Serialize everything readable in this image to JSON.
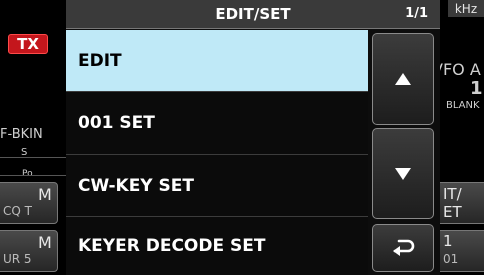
{
  "background": {
    "tx_badge": "TX",
    "freq_unit": "kHz",
    "mode_left": "F-BKIN",
    "meter_s": "S",
    "meter_po": "Po",
    "vfo_label": "VFO A",
    "vfo_digit": "1",
    "blank_label": "BLANK",
    "left_buttons": [
      {
        "top": "M",
        "bottom": "CQ T"
      },
      {
        "top": "M",
        "bottom": "UR 5"
      }
    ],
    "right_buttons": [
      {
        "top": "IT/",
        "bottom": "ET"
      },
      {
        "top": "1",
        "bottom": "01"
      }
    ]
  },
  "dialog": {
    "title": "EDIT/SET",
    "page_indicator": "1/1",
    "items": [
      {
        "label": "EDIT",
        "selected": true
      },
      {
        "label": "001 SET",
        "selected": false
      },
      {
        "label": "CW-KEY SET",
        "selected": false
      },
      {
        "label": "KEYER DECODE SET",
        "selected": false
      }
    ],
    "nav": {
      "up_icon": "triangle-up-icon",
      "down_icon": "triangle-down-icon",
      "back_icon": "return-arrow-icon"
    }
  },
  "colors": {
    "selected_item_bg": "#bfe9f7",
    "title_bar_bg": "#3a3a3a",
    "tx_badge": "#c4161c"
  }
}
